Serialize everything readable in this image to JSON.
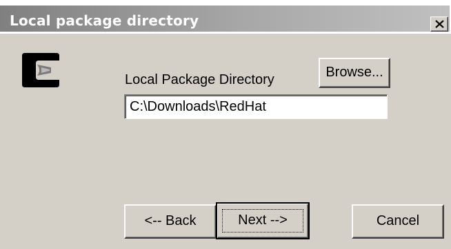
{
  "window": {
    "title": "Local package directory",
    "close_label": "×"
  },
  "content": {
    "directory_label": "Local Package Directory",
    "browse_label": "Browse...",
    "directory_value": "C:\\Downloads\\RedHat"
  },
  "footer": {
    "back_label": "<-- Back",
    "next_label": "Next -->",
    "cancel_label": "Cancel"
  },
  "icons": {
    "logo": "cygwin-logo-icon",
    "close": "close-icon"
  },
  "colors": {
    "dialog_bg": "#d4d0c8",
    "titlebar_start": "#808080",
    "titlebar_end": "#c0c0c0"
  }
}
